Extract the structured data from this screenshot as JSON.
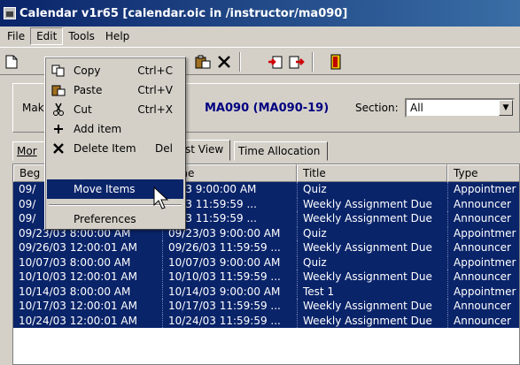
{
  "window": {
    "title": "Calendar v1r65 [calendar.oic in /instructor/ma090]"
  },
  "menubar": {
    "file": "File",
    "edit": "Edit",
    "tools": "Tools",
    "help": "Help"
  },
  "toolbar": {
    "icons": [
      "new-document-icon",
      "paste-icon",
      "delete-icon",
      "import-icon",
      "export-icon",
      "exit-door-icon"
    ]
  },
  "header": {
    "make_label": "Mak",
    "course": "MA090 (MA090-19)",
    "section_label": "Section:",
    "section_value": "All"
  },
  "tabs": {
    "month": "Mor",
    "list": "st View",
    "time_alloc": "Time Allocation"
  },
  "table": {
    "columns": [
      "Beg",
      "Time",
      "Title",
      "Type"
    ],
    "rows": [
      {
        "begin": "09/",
        "end": "9/03 9:00:00 AM",
        "title": "Quiz",
        "type": "Appointmer"
      },
      {
        "begin": "09/",
        "end": "2/03 11:59:59 ...",
        "title": "Weekly Assignment Due",
        "type": "Announcer"
      },
      {
        "begin": "09/",
        "end": "9/03 11:59:59 ...",
        "title": "Weekly Assignment Due",
        "type": "Announcer"
      },
      {
        "begin": "09/23/03 8:00:00 AM",
        "end": "09/23/03 9:00:00 AM",
        "title": "Quiz",
        "type": "Appointmer"
      },
      {
        "begin": "09/26/03 12:00:01 AM",
        "end": "09/26/03 11:59:59 ...",
        "title": "Weekly Assignment Due",
        "type": "Announcer"
      },
      {
        "begin": "10/07/03 8:00:00 AM",
        "end": "10/07/03 9:00:00 AM",
        "title": "Quiz",
        "type": "Appointmer"
      },
      {
        "begin": "10/10/03 12:00:01 AM",
        "end": "10/10/03 11:59:59 ...",
        "title": "Weekly Assignment Due",
        "type": "Announcer"
      },
      {
        "begin": "10/14/03 8:00:00 AM",
        "end": "10/14/03 9:00:00 AM",
        "title": "Test 1",
        "type": "Appointmer"
      },
      {
        "begin": "10/17/03 12:00:01 AM",
        "end": "10/17/03 11:59:59 ...",
        "title": "Weekly Assignment Due",
        "type": "Announcer"
      },
      {
        "begin": "10/24/03 12:00:01 AM",
        "end": "10/24/03 11:59:59 ...",
        "title": "Weekly Assignment Due",
        "type": "Announcer"
      }
    ]
  },
  "edit_menu": {
    "copy": {
      "label": "Copy",
      "shortcut": "Ctrl+C"
    },
    "paste": {
      "label": "Paste",
      "shortcut": "Ctrl+V"
    },
    "cut": {
      "label": "Cut",
      "shortcut": "Ctrl+X"
    },
    "add_item": {
      "label": "Add item"
    },
    "delete_item": {
      "label": "Delete Item",
      "shortcut": "Del"
    },
    "move_items": {
      "label": "Move Items"
    },
    "preferences": {
      "label": "Preferences"
    }
  },
  "colors": {
    "selection": "#0a246a",
    "chrome": "#d4d0c8",
    "course": "#000080"
  }
}
